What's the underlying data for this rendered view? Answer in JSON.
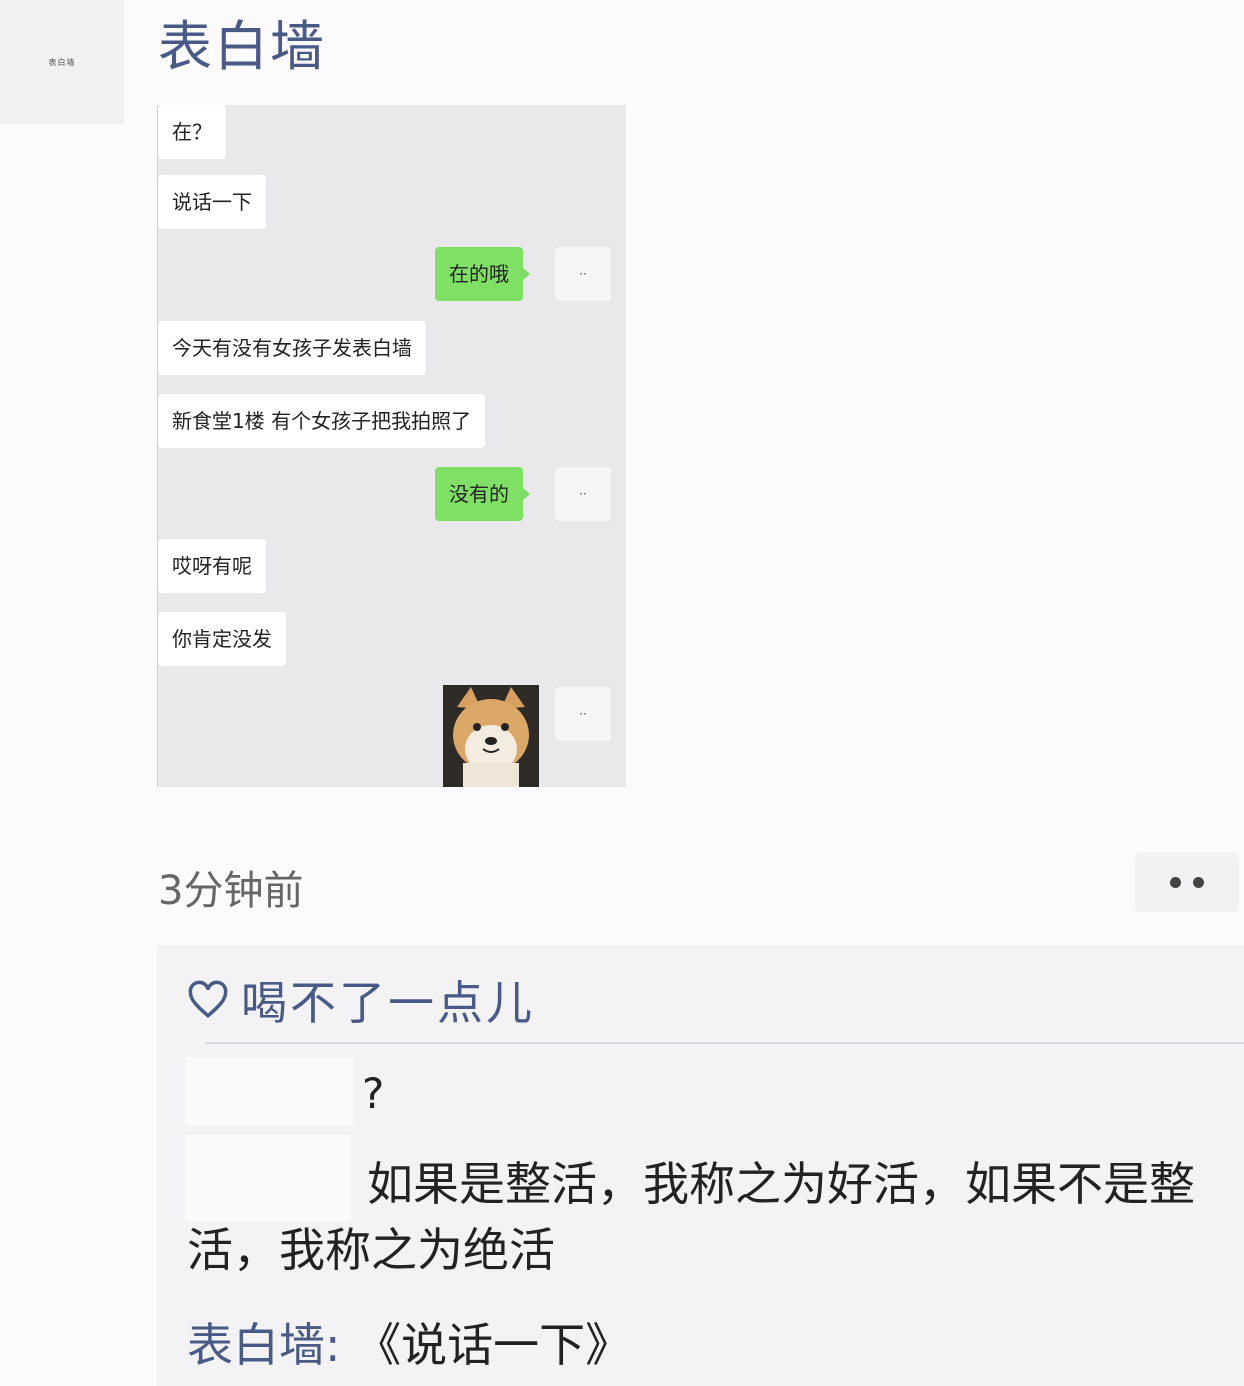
{
  "header": {
    "avatar_text": "表白墙",
    "title": "表白墙"
  },
  "chat": {
    "messages": [
      {
        "side": "left",
        "text": "在？"
      },
      {
        "side": "left",
        "text": "说话一下"
      },
      {
        "side": "right",
        "text": "在的哦"
      },
      {
        "side": "left",
        "text": "今天有没有女孩子发表白墙"
      },
      {
        "side": "left",
        "text": "新食堂1楼 有个女孩子把我拍照了"
      },
      {
        "side": "right",
        "text": "没有的"
      },
      {
        "side": "left",
        "text": "哎呀有呢"
      },
      {
        "side": "left",
        "text": "你肯定没发"
      },
      {
        "side": "right",
        "image": "shiba-dog-sticker"
      }
    ],
    "self_avatar_text": "··"
  },
  "post": {
    "time": "3分钟前",
    "more_icon": "more-dots-icon"
  },
  "comments": {
    "likes_icon": "heart-icon",
    "likes": "喝不了一点儿",
    "items": [
      {
        "text": "?"
      },
      {
        "text": "如果是整活，我称之为好活，如果不是整活，我称之为绝活"
      },
      {
        "author": "表白墙",
        "separator": ": ",
        "text": "《说话一下》"
      }
    ]
  },
  "colors": {
    "name_blue": "#4a5a86",
    "bubble_green": "#7fe065",
    "chat_bg": "#e9e9eb"
  }
}
